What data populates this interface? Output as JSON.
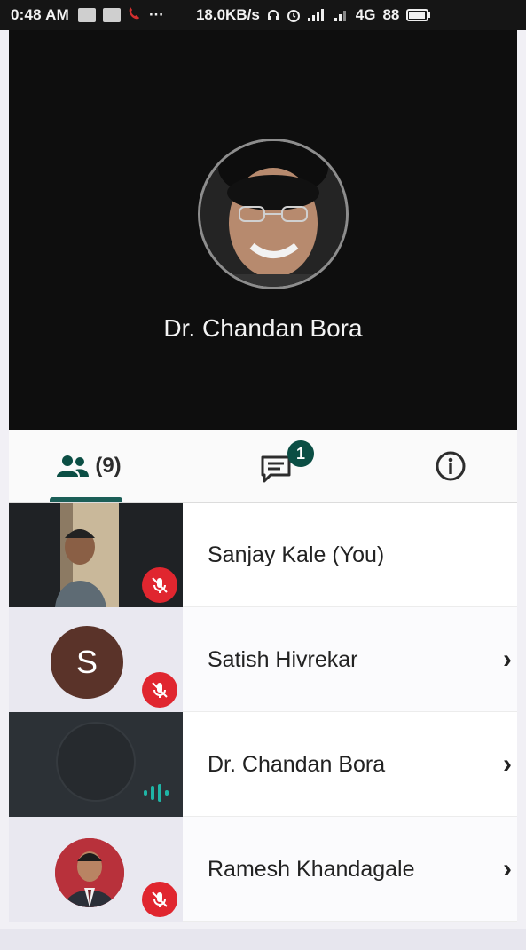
{
  "status_bar": {
    "time": "0:48 AM",
    "ellipsis": "···",
    "network_speed": "18.0KB/s",
    "network_type": "4G",
    "battery": "88"
  },
  "stage": {
    "speaker_name": "Dr. Chandan Bora"
  },
  "tabs": {
    "participants_count": "(9)",
    "chat_badge": "1"
  },
  "participants": [
    {
      "name": "Sanjay Kale (You)",
      "muted": true,
      "has_chevron": false
    },
    {
      "name": "Satish Hivrekar",
      "avatar_letter": "S",
      "muted": true,
      "has_chevron": true,
      "chevron": "›"
    },
    {
      "name": "Dr. Chandan Bora",
      "muted": false,
      "speaking": true,
      "has_chevron": true,
      "chevron": "›"
    },
    {
      "name": "Ramesh Khandagale",
      "muted": true,
      "has_chevron": true,
      "chevron": "›"
    }
  ],
  "colors": {
    "accent": "#0b4e44",
    "mute_red": "#e0262f",
    "speaking_teal": "#1fb5a6"
  },
  "icons": {
    "participants_tab": "people-icon",
    "chat_tab": "chat-icon",
    "info_tab": "info-icon",
    "muted": "mic-off-icon",
    "speaking": "audio-wave-icon"
  }
}
